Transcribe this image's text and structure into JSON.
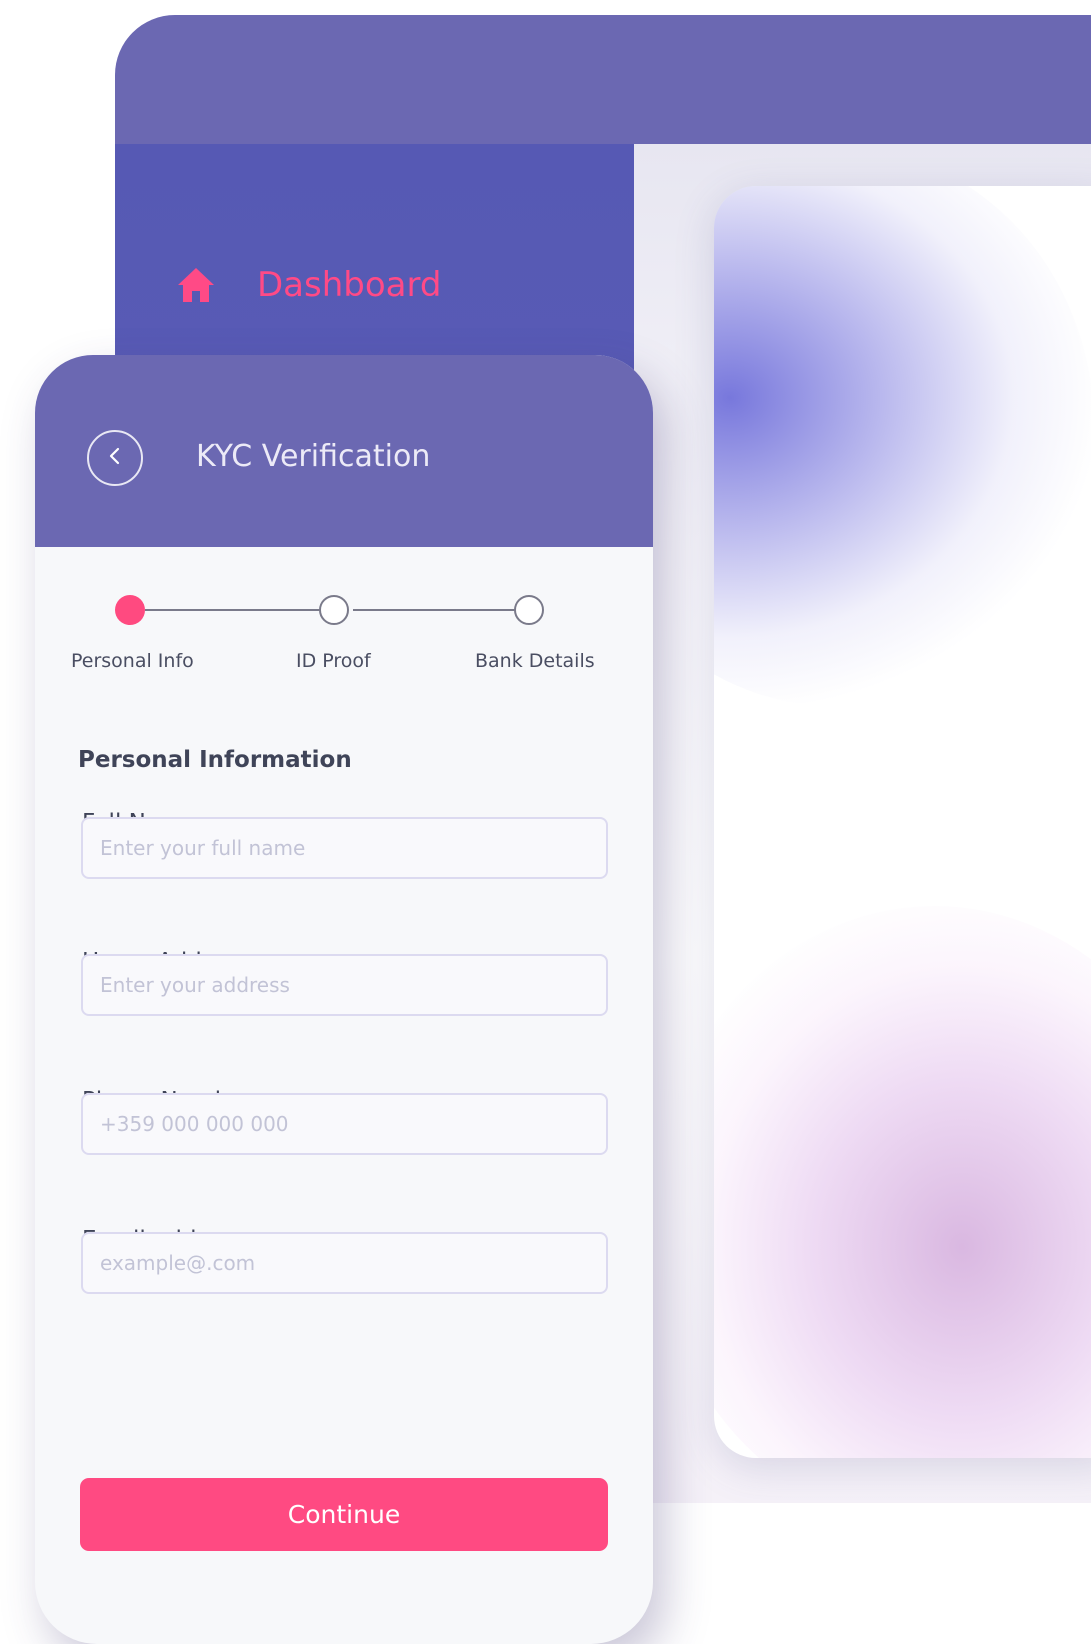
{
  "dashboard": {
    "nav": {
      "item_label": "Dashboard",
      "item_icon": "home-icon"
    },
    "colors": {
      "topbar": "#6b68b2",
      "sidebar": "#5659b4",
      "accent": "#ff4a86"
    }
  },
  "kyc": {
    "header": {
      "title": "KYC Verification",
      "back_icon": "chevron-left-icon"
    },
    "steps": [
      {
        "label": "Personal Info",
        "state": "active"
      },
      {
        "label": "ID Proof",
        "state": "inactive"
      },
      {
        "label": "Bank Details",
        "state": "inactive"
      }
    ],
    "form": {
      "section_title": "Personal Information",
      "fields": [
        {
          "label": "Full Name",
          "placeholder": "Enter your full name",
          "value": ""
        },
        {
          "label": "Home Address",
          "placeholder": "Enter your address",
          "value": ""
        },
        {
          "label": "Phone Number",
          "placeholder": "+359 000 000 000",
          "value": ""
        },
        {
          "label": "Email address",
          "placeholder": "example@.com",
          "value": ""
        }
      ],
      "submit_label": "Continue"
    },
    "colors": {
      "header": "#6b68b2",
      "primary": "#ff4a82",
      "card_background": "#f7f8fa"
    }
  }
}
